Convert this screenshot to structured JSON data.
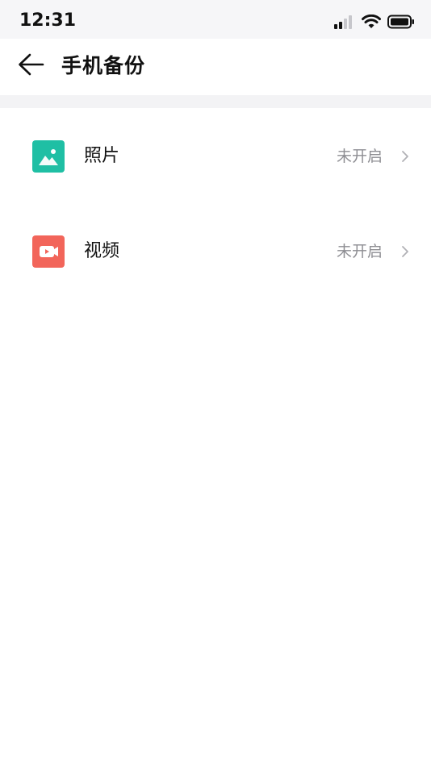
{
  "status_bar": {
    "time": "12:31",
    "icons": [
      "cellular-signal-icon",
      "wifi-icon",
      "battery-icon"
    ]
  },
  "header": {
    "back_icon": "arrow-left-icon",
    "title": "手机备份"
  },
  "backup_items": [
    {
      "label": "照片",
      "status": "未开启",
      "icon": "photo-icon",
      "icon_color": "#1fbfa4"
    },
    {
      "label": "视频",
      "status": "未开启",
      "icon": "video-icon",
      "icon_color": "#f2655a"
    }
  ],
  "colors": {
    "status_text": "#8e8e93",
    "background": "#ffffff",
    "separator_band": "#f3f3f5"
  }
}
